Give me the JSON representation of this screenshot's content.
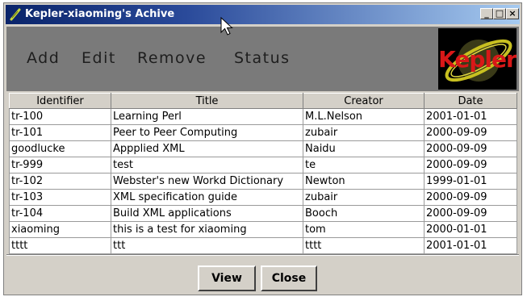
{
  "window": {
    "title": "Kepler-xiaoming's Achive",
    "minimize_label": "_",
    "maximize_label": "□",
    "close_label": "×"
  },
  "toolbar": {
    "items": [
      {
        "label": "Add"
      },
      {
        "label": "Edit"
      },
      {
        "label": "Remove"
      },
      {
        "label": "Status"
      }
    ],
    "logo_text": "Kepler"
  },
  "table": {
    "columns": [
      "Identifier",
      "Title",
      "Creator",
      "Date"
    ],
    "rows": [
      [
        "tr-100",
        "Learning Perl",
        "M.L.Nelson",
        "2001-01-01"
      ],
      [
        "tr-101",
        "Peer to Peer Computing",
        "zubair",
        "2000-09-09"
      ],
      [
        "goodlucke",
        "Appplied XML",
        "Naidu",
        "2000-09-09"
      ],
      [
        "tr-999",
        "test",
        "te",
        "2000-09-09"
      ],
      [
        "tr-102",
        "Webster's new Workd Dictionary",
        "Newton",
        "1999-01-01"
      ],
      [
        "tr-103",
        "XML specification guide",
        "zubair",
        "2000-09-09"
      ],
      [
        "tr-104",
        "Build XML applications",
        "Booch",
        "2000-09-09"
      ],
      [
        "xiaoming",
        "this is a test for xiaoming",
        "tom",
        "2000-01-01"
      ],
      [
        "tttt",
        "ttt",
        "tttt",
        "2001-01-01"
      ]
    ]
  },
  "buttons": {
    "view_label": "View",
    "close_label": "Close"
  },
  "colors": {
    "titlebar_start": "#0a246a",
    "titlebar_end": "#a6caf0",
    "toolbar_bg": "#7a7a7a",
    "window_bg": "#d4d0c8",
    "logo_text": "#d81818"
  }
}
